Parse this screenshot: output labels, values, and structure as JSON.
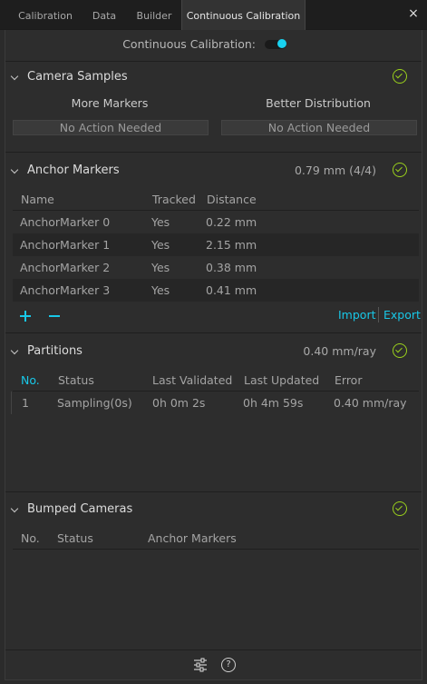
{
  "tabs": [
    {
      "label": "Calibration",
      "active": false
    },
    {
      "label": "Data",
      "active": false
    },
    {
      "label": "Builder",
      "active": false
    },
    {
      "label": "Continuous Calibration",
      "active": true
    }
  ],
  "close_icon": "×",
  "continuous_calibration": {
    "label": "Continuous Calibration:",
    "enabled": true
  },
  "camera_samples": {
    "title": "Camera Samples",
    "more_markers_label": "More Markers",
    "more_markers_status": "No Action Needed",
    "better_distribution_label": "Better Distribution",
    "better_distribution_status": "No Action Needed"
  },
  "anchor_markers": {
    "title": "Anchor Markers",
    "summary": "0.79 mm (4/4)",
    "columns": {
      "name": "Name",
      "tracked": "Tracked",
      "distance": "Distance"
    },
    "rows": [
      {
        "name": "AnchorMarker 0",
        "tracked": "Yes",
        "distance": "0.22 mm"
      },
      {
        "name": "AnchorMarker 1",
        "tracked": "Yes",
        "distance": "2.15 mm"
      },
      {
        "name": "AnchorMarker 2",
        "tracked": "Yes",
        "distance": "0.38 mm"
      },
      {
        "name": "AnchorMarker 3",
        "tracked": "Yes",
        "distance": "0.41 mm"
      }
    ],
    "import_label": "Import",
    "export_label": "Export"
  },
  "partitions": {
    "title": "Partitions",
    "summary": "0.40 mm/ray",
    "columns": {
      "no": "No.",
      "status": "Status",
      "last_validated": "Last Validated",
      "last_updated": "Last Updated",
      "error": "Error"
    },
    "rows": [
      {
        "no": "1",
        "status": "Sampling(0s)",
        "last_validated": "0h 0m 2s",
        "last_updated": "0h 4m 59s",
        "error": "0.40 mm/ray"
      }
    ]
  },
  "bumped_cameras": {
    "title": "Bumped Cameras",
    "columns": {
      "no": "No.",
      "status": "Status",
      "anchor_markers": "Anchor Markers"
    }
  },
  "colors": {
    "accent": "#18c8e8",
    "ok": "#9ad01c",
    "background": "#2d2d2d"
  },
  "icons": {
    "settings": "sliders-icon",
    "help": "?"
  }
}
